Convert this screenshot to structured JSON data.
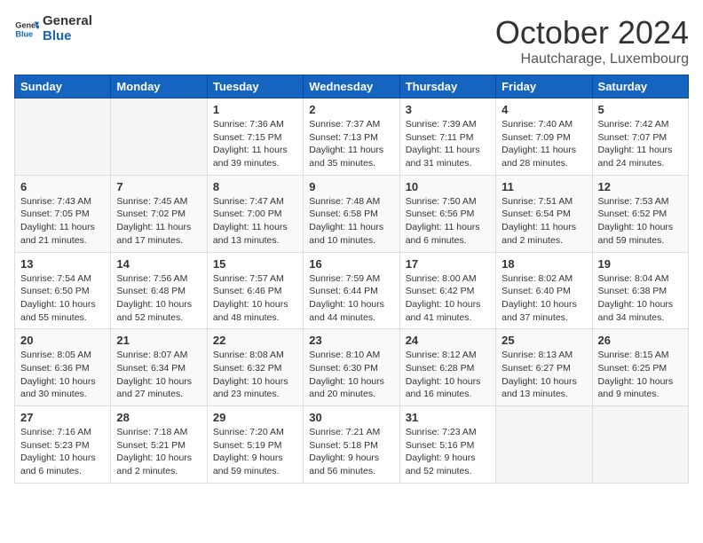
{
  "logo": {
    "line1": "General",
    "line2": "Blue"
  },
  "title": "October 2024",
  "location": "Hautcharage, Luxembourg",
  "days_header": [
    "Sunday",
    "Monday",
    "Tuesday",
    "Wednesday",
    "Thursday",
    "Friday",
    "Saturday"
  ],
  "weeks": [
    [
      {
        "day": "",
        "info": ""
      },
      {
        "day": "",
        "info": ""
      },
      {
        "day": "1",
        "info": "Sunrise: 7:36 AM\nSunset: 7:15 PM\nDaylight: 11 hours and 39 minutes."
      },
      {
        "day": "2",
        "info": "Sunrise: 7:37 AM\nSunset: 7:13 PM\nDaylight: 11 hours and 35 minutes."
      },
      {
        "day": "3",
        "info": "Sunrise: 7:39 AM\nSunset: 7:11 PM\nDaylight: 11 hours and 31 minutes."
      },
      {
        "day": "4",
        "info": "Sunrise: 7:40 AM\nSunset: 7:09 PM\nDaylight: 11 hours and 28 minutes."
      },
      {
        "day": "5",
        "info": "Sunrise: 7:42 AM\nSunset: 7:07 PM\nDaylight: 11 hours and 24 minutes."
      }
    ],
    [
      {
        "day": "6",
        "info": "Sunrise: 7:43 AM\nSunset: 7:05 PM\nDaylight: 11 hours and 21 minutes."
      },
      {
        "day": "7",
        "info": "Sunrise: 7:45 AM\nSunset: 7:02 PM\nDaylight: 11 hours and 17 minutes."
      },
      {
        "day": "8",
        "info": "Sunrise: 7:47 AM\nSunset: 7:00 PM\nDaylight: 11 hours and 13 minutes."
      },
      {
        "day": "9",
        "info": "Sunrise: 7:48 AM\nSunset: 6:58 PM\nDaylight: 11 hours and 10 minutes."
      },
      {
        "day": "10",
        "info": "Sunrise: 7:50 AM\nSunset: 6:56 PM\nDaylight: 11 hours and 6 minutes."
      },
      {
        "day": "11",
        "info": "Sunrise: 7:51 AM\nSunset: 6:54 PM\nDaylight: 11 hours and 2 minutes."
      },
      {
        "day": "12",
        "info": "Sunrise: 7:53 AM\nSunset: 6:52 PM\nDaylight: 10 hours and 59 minutes."
      }
    ],
    [
      {
        "day": "13",
        "info": "Sunrise: 7:54 AM\nSunset: 6:50 PM\nDaylight: 10 hours and 55 minutes."
      },
      {
        "day": "14",
        "info": "Sunrise: 7:56 AM\nSunset: 6:48 PM\nDaylight: 10 hours and 52 minutes."
      },
      {
        "day": "15",
        "info": "Sunrise: 7:57 AM\nSunset: 6:46 PM\nDaylight: 10 hours and 48 minutes."
      },
      {
        "day": "16",
        "info": "Sunrise: 7:59 AM\nSunset: 6:44 PM\nDaylight: 10 hours and 44 minutes."
      },
      {
        "day": "17",
        "info": "Sunrise: 8:00 AM\nSunset: 6:42 PM\nDaylight: 10 hours and 41 minutes."
      },
      {
        "day": "18",
        "info": "Sunrise: 8:02 AM\nSunset: 6:40 PM\nDaylight: 10 hours and 37 minutes."
      },
      {
        "day": "19",
        "info": "Sunrise: 8:04 AM\nSunset: 6:38 PM\nDaylight: 10 hours and 34 minutes."
      }
    ],
    [
      {
        "day": "20",
        "info": "Sunrise: 8:05 AM\nSunset: 6:36 PM\nDaylight: 10 hours and 30 minutes."
      },
      {
        "day": "21",
        "info": "Sunrise: 8:07 AM\nSunset: 6:34 PM\nDaylight: 10 hours and 27 minutes."
      },
      {
        "day": "22",
        "info": "Sunrise: 8:08 AM\nSunset: 6:32 PM\nDaylight: 10 hours and 23 minutes."
      },
      {
        "day": "23",
        "info": "Sunrise: 8:10 AM\nSunset: 6:30 PM\nDaylight: 10 hours and 20 minutes."
      },
      {
        "day": "24",
        "info": "Sunrise: 8:12 AM\nSunset: 6:28 PM\nDaylight: 10 hours and 16 minutes."
      },
      {
        "day": "25",
        "info": "Sunrise: 8:13 AM\nSunset: 6:27 PM\nDaylight: 10 hours and 13 minutes."
      },
      {
        "day": "26",
        "info": "Sunrise: 8:15 AM\nSunset: 6:25 PM\nDaylight: 10 hours and 9 minutes."
      }
    ],
    [
      {
        "day": "27",
        "info": "Sunrise: 7:16 AM\nSunset: 5:23 PM\nDaylight: 10 hours and 6 minutes."
      },
      {
        "day": "28",
        "info": "Sunrise: 7:18 AM\nSunset: 5:21 PM\nDaylight: 10 hours and 2 minutes."
      },
      {
        "day": "29",
        "info": "Sunrise: 7:20 AM\nSunset: 5:19 PM\nDaylight: 9 hours and 59 minutes."
      },
      {
        "day": "30",
        "info": "Sunrise: 7:21 AM\nSunset: 5:18 PM\nDaylight: 9 hours and 56 minutes."
      },
      {
        "day": "31",
        "info": "Sunrise: 7:23 AM\nSunset: 5:16 PM\nDaylight: 9 hours and 52 minutes."
      },
      {
        "day": "",
        "info": ""
      },
      {
        "day": "",
        "info": ""
      }
    ]
  ]
}
